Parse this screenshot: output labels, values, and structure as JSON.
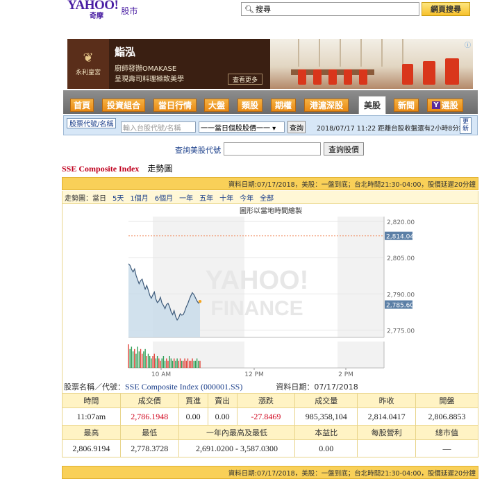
{
  "header": {
    "logo": "YAHOO!",
    "logo_sub": "奇摩",
    "logo_section": "股市",
    "search_placeholder": "搜尋",
    "search_button": "網頁搜尋"
  },
  "ad": {
    "brand": "永利皇宮",
    "title": "鮨泓",
    "line1": "廚師發辦OMAKASE",
    "line2": "呈現壽司料理極致美學",
    "more": "查看更多"
  },
  "nav": {
    "tabs": [
      "首頁",
      "投資組合",
      "當日行情",
      "大盤",
      "類股",
      "期權",
      "港滬深股",
      "美股",
      "新聞",
      "選股"
    ],
    "active": "美股"
  },
  "quote_bar": {
    "label": "股票代號/名稱",
    "input_placeholder": "輸入台股代號/名稱",
    "select": "一一當日個股股價一一 ▾",
    "button": "查詢",
    "status": "2018/07/17 11:22 距離台股收盤還有2小時8分鐘",
    "refresh_1": "更",
    "refresh_2": "新"
  },
  "us_search": {
    "label": "查詢美股代號",
    "button": "查詢股價"
  },
  "page": {
    "title": "SSE Composite Index",
    "subtitle": "走勢圖"
  },
  "strip_text": "資料日期:07/17/2018，美股：一盤到底；台北時間21:30-04:00，股價延遲20分鐘",
  "periods": {
    "label": "走勢圖：當日",
    "items": [
      "5天",
      "1個月",
      "6個月",
      "一年",
      "五年",
      "十年",
      "今年",
      "全部"
    ]
  },
  "chart_data": {
    "type": "line",
    "title": "圖形以當地時間繪製",
    "x_ticks": [
      "10 AM",
      "12 PM",
      "2 PM"
    ],
    "y_ticks": [
      "2,820.00",
      "2,805.00",
      "2,790.00",
      "2,775.00"
    ],
    "y_tick_values": [
      2820,
      2805,
      2790,
      2775
    ],
    "ylim": [
      2772,
      2822
    ],
    "reference_label": "2,814.04",
    "reference_value": 2814.04,
    "last_label": "2,785.60",
    "last_value": 2785.6,
    "watermark": [
      "YAHOO!",
      "FINANCE"
    ],
    "series": [
      {
        "values": [
          2802.5,
          2801.8,
          2800.2,
          2799.1,
          2800.3,
          2797.6,
          2795.9,
          2794.2,
          2795.5,
          2796.1,
          2793.8,
          2792.0,
          2793.5,
          2791.6,
          2789.4,
          2788.2,
          2789.6,
          2790.8,
          2787.9,
          2786.4,
          2787.1,
          2788.6,
          2786.2,
          2785.2,
          2783.9,
          2785.6,
          2786.1,
          2784.7,
          2782.6,
          2781.4,
          2783.1,
          2780.6,
          2779.2,
          2780.1,
          2781.8,
          2781.2,
          2781.4,
          2782.9,
          2784.7,
          2786.0,
          2787.8,
          2789.3,
          2790.5,
          2789.7,
          2788.4,
          2787.1,
          2786.2,
          2786.9
        ]
      }
    ],
    "volume": [
      10,
      8,
      9,
      7,
      8,
      6,
      9,
      7,
      8,
      6,
      7,
      8,
      5,
      6,
      5,
      4,
      5,
      6,
      4,
      5,
      4,
      3,
      4,
      5,
      3,
      4,
      3,
      5,
      4,
      3,
      4,
      3,
      4,
      3,
      4,
      3,
      3,
      4,
      3,
      4,
      3,
      3,
      4,
      3,
      3,
      4,
      3,
      3
    ]
  },
  "info": {
    "name_label": "股票名稱／代號：",
    "name": "SSE Composite Index (000001.SS)",
    "date_label": "資料日期：07/17/2018",
    "row1_headers": [
      "時間",
      "成交價",
      "買進",
      "賣出",
      "漲跌",
      "成交量",
      "昨收",
      "開盤"
    ],
    "row1_values": [
      "11:07am",
      "2,786.1948",
      "0.00",
      "0.00",
      "-27.8469",
      "985,358,104",
      "2,814.0417",
      "2,806.8853"
    ],
    "row2_headers": [
      "最高",
      "最低",
      "一年內最高及最低",
      "本益比",
      "每股營利",
      "總市值"
    ],
    "row2_values": [
      "2,806.9194",
      "2,778.3728",
      "2,691.0200 - 3,587.0300",
      "0.00",
      "",
      "—"
    ]
  },
  "colors": {
    "accent_red": "#d0021b",
    "link_blue": "#1a3e8a",
    "strip_yellow": "#f9d058",
    "tab_orange": "#e98a14",
    "chart_line": "#3d5a7a",
    "chart_fill": "#c9dcea"
  }
}
